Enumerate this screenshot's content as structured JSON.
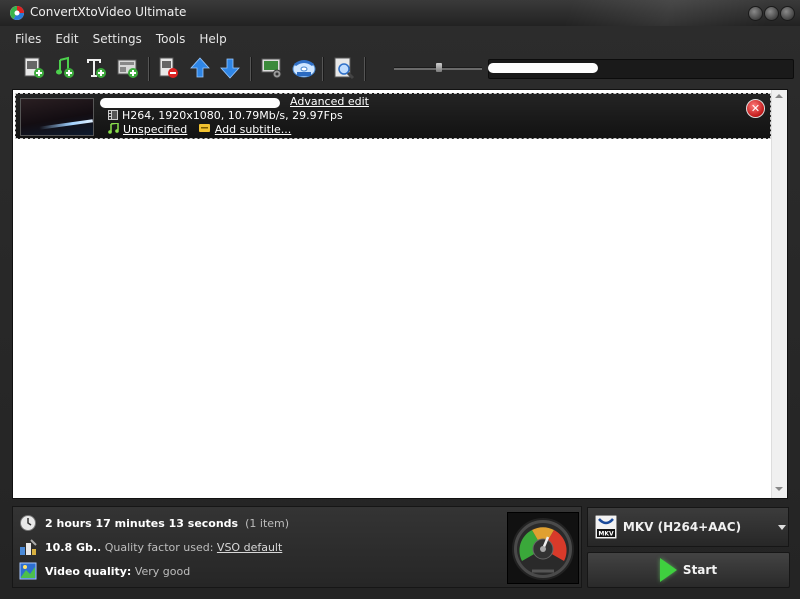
{
  "window": {
    "title": "ConvertXtoVideo Ultimate"
  },
  "menu": {
    "items": [
      "Files",
      "Edit",
      "Settings",
      "Tools",
      "Help"
    ]
  },
  "toolbar": {
    "buttons": [
      {
        "name": "add-video-icon"
      },
      {
        "name": "add-audio-icon"
      },
      {
        "name": "add-text-icon"
      },
      {
        "name": "add-chapter-icon"
      },
      {
        "name": "remove-file-icon"
      },
      {
        "name": "move-up-icon"
      },
      {
        "name": "move-down-icon"
      },
      {
        "name": "preview-settings-icon"
      },
      {
        "name": "burn-disc-icon"
      },
      {
        "name": "zoom-preview-icon"
      }
    ],
    "search_value": ""
  },
  "file_list": {
    "items": [
      {
        "advanced_edit": "Advanced edit",
        "video_info": "H264, 1920x1080, 10.79Mb/s, 29.97Fps",
        "audio_label": "Unspecified",
        "subtitle_label": "Add subtitle..."
      }
    ]
  },
  "info": {
    "duration": "2 hours 17 minutes 13 seconds",
    "items_count": "(1 item)",
    "size": "10.8 Gb..",
    "quality_factor_label": "Quality factor used:",
    "quality_factor_value": "VSO default",
    "video_quality_label": "Video quality:",
    "video_quality_value": "Very good"
  },
  "output": {
    "format_label": "MKV (H264+AAC)",
    "format_icon_text": "MKV",
    "start_label": "Start"
  },
  "colors": {
    "accent_green": "#3fcf3f",
    "close_red": "#c01a1a"
  }
}
